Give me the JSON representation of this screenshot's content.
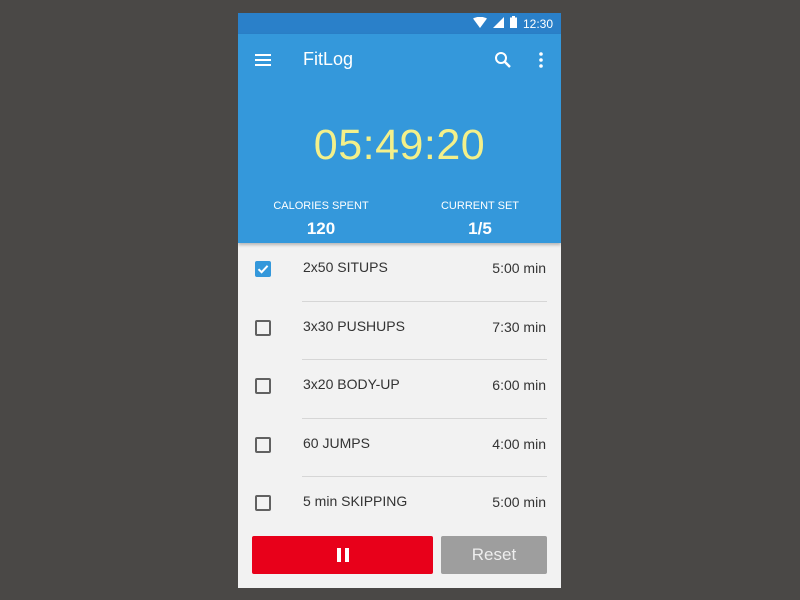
{
  "status_bar": {
    "time": "12:30",
    "icons": [
      "wifi-icon",
      "signal-icon",
      "battery-icon"
    ]
  },
  "toolbar": {
    "title": "FitLog",
    "icons": [
      "menu-icon",
      "search-icon",
      "more-vert-icon"
    ]
  },
  "timer": {
    "value": "05:49:20"
  },
  "stats": {
    "calories_label": "CALORIES SPENT",
    "calories_value": "120",
    "set_label": "CURRENT SET",
    "set_value": "1/5"
  },
  "exercises": [
    {
      "name": "2x50 SITUPS",
      "duration": "5:00 min",
      "checked": true
    },
    {
      "name": "3x30 PUSHUPS",
      "duration": "7:30 min",
      "checked": false
    },
    {
      "name": "3x20 BODY-UP",
      "duration": "6:00 min",
      "checked": false
    },
    {
      "name": "60 JUMPS",
      "duration": "4:00 min",
      "checked": false
    },
    {
      "name": "5 min SKIPPING",
      "duration": "5:00 min",
      "checked": false
    }
  ],
  "buttons": {
    "pause_icon": "pause-icon",
    "reset_label": "Reset"
  },
  "colors": {
    "header": "#3498db",
    "status_bar": "#2a80c9",
    "timer_text": "#f3f08a",
    "pause_button": "#e8001a",
    "reset_button": "#9e9e9e",
    "checkbox_checked": "#3498db"
  }
}
